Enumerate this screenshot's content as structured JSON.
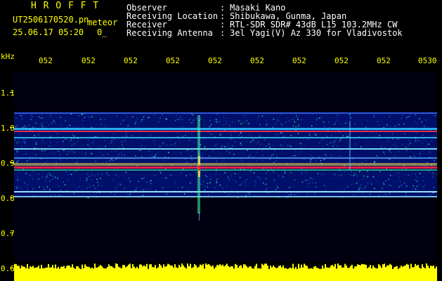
{
  "header": {
    "title": "H R O F F T",
    "filename": "UT2506170520.pn",
    "mode": "meteor",
    "datetime": "25.06.17 05:20",
    "counter": "0_",
    "fields": [
      {
        "label": "Observer",
        "sep": ":",
        "value": "Masaki Kano"
      },
      {
        "label": "Receiving Location",
        "sep": ":",
        "value": "Shibukawa, Gunma, Japan"
      },
      {
        "label": "Receiver",
        "sep": ":",
        "value": "RTL-SDR SDR# 43dB L15 103.2MHz CW"
      },
      {
        "label": "Receiving Antenna",
        "sep": ":",
        "value": "3el Yagi(V) Az 330 for Vladivostok"
      }
    ]
  },
  "axis": {
    "unit": "kHz",
    "time_ticks": [
      "052",
      "052",
      "052",
      "052",
      "052",
      "052",
      "052",
      "052",
      "052",
      "0530"
    ],
    "freq_ticks": [
      "1.1",
      "1.0",
      "0.9",
      "0.8",
      "0.7",
      "0.6"
    ]
  },
  "colors": {
    "text": "#ffff00",
    "noise": "#ffff00",
    "background": "#000000"
  }
}
